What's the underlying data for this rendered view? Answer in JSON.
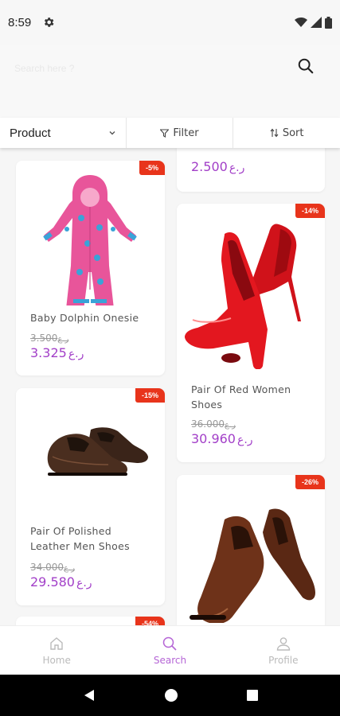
{
  "status": {
    "time": "8:59"
  },
  "search": {
    "placeholder": "Search here ?"
  },
  "toolbar": {
    "product_label": "Product",
    "filter_label": "Filter",
    "sort_label": "Sort"
  },
  "products": [
    {
      "name": "Baby Dolphin Onesie",
      "discount": "-5%",
      "old_price": "3.500",
      "price": "3.325",
      "currency": "ر.ع"
    },
    {
      "name": "",
      "discount": "",
      "old_price": "",
      "price": "2.500",
      "currency": "ر.ع"
    },
    {
      "name": "Pair Of Red Women Shoes",
      "discount": "-14%",
      "old_price": "36.000",
      "price": "30.960",
      "currency": "ر.ع"
    },
    {
      "name": "Pair Of Polished Leather Men Shoes",
      "discount": "-15%",
      "old_price": "34.000",
      "price": "29.580",
      "currency": "ر.ع"
    },
    {
      "name": "",
      "discount": "-26%",
      "old_price": "",
      "price": "",
      "currency": ""
    },
    {
      "name": "",
      "discount": "-54%",
      "old_price": "",
      "price": "",
      "currency": ""
    }
  ],
  "bottom_nav": {
    "home": "Home",
    "search": "Search",
    "profile": "Profile"
  },
  "colors": {
    "accent": "#a23fc8",
    "badge": "#e8341b",
    "nav_active": "#b565d6"
  }
}
